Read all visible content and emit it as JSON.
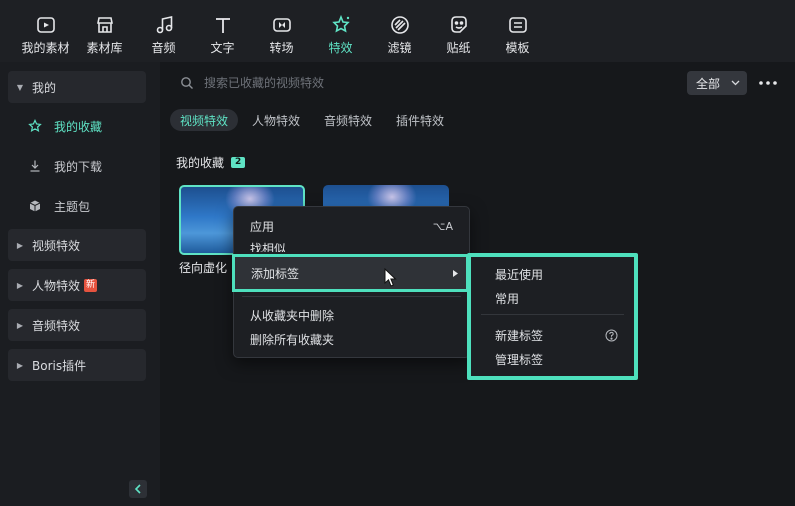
{
  "toolbar": {
    "items": [
      {
        "label": "我的素材",
        "icon": "media-icon"
      },
      {
        "label": "素材库",
        "icon": "store-icon"
      },
      {
        "label": "音频",
        "icon": "music-note-icon"
      },
      {
        "label": "文字",
        "icon": "text-icon"
      },
      {
        "label": "转场",
        "icon": "transition-icon"
      },
      {
        "label": "特效",
        "icon": "effects-icon",
        "active": true
      },
      {
        "label": "滤镜",
        "icon": "filter-icon"
      },
      {
        "label": "贴纸",
        "icon": "sticker-icon"
      },
      {
        "label": "模板",
        "icon": "template-icon"
      }
    ]
  },
  "sidebar": {
    "mine_label": "我的",
    "favorites_label": "我的收藏",
    "downloads_label": "我的下载",
    "theme_pack_label": "主题包",
    "groups": [
      {
        "label": "视频特效"
      },
      {
        "label": "人物特效",
        "badge": "新"
      },
      {
        "label": "音频特效"
      },
      {
        "label": "Boris插件"
      }
    ]
  },
  "main": {
    "search_placeholder": "搜索已收藏的视频特效",
    "filter_value": "全部",
    "tabs": [
      "视频特效",
      "人物特效",
      "音频特效",
      "插件特效"
    ],
    "active_tab": "视频特效",
    "section_title": "我的收藏",
    "section_count": "2",
    "thumbnail_label": "径向虚化"
  },
  "context_menu": {
    "apply": "应用",
    "apply_shortcut": "⌥A",
    "find_similar": "找相似",
    "add_tag": "添加标签",
    "remove_from_folder": "从收藏夹中删除",
    "remove_all": "删除所有收藏夹"
  },
  "submenu": {
    "recent": "最近使用",
    "common": "常用",
    "new_tag": "新建标签",
    "manage_tags": "管理标签"
  },
  "colors": {
    "accent": "#5fe3c5",
    "highlight_border": "#4ee0bd",
    "new_badge": "#e5533f"
  }
}
